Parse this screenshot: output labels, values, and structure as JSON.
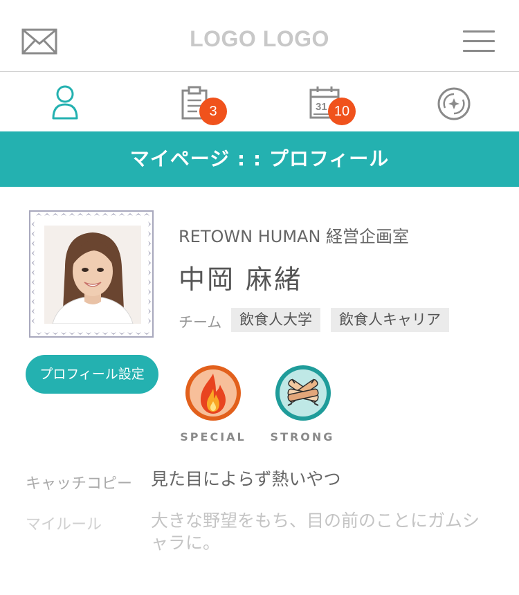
{
  "header": {
    "logo_text": "LOGO LOGO",
    "mail_icon": "envelope-icon",
    "menu_icon": "hamburger-menu-icon"
  },
  "tabs": [
    {
      "icon": "user-icon",
      "active": true,
      "badge": null
    },
    {
      "icon": "clipboard-icon",
      "active": false,
      "badge": "3"
    },
    {
      "icon": "calendar-icon",
      "active": false,
      "badge": "10",
      "calendar_day": "31"
    },
    {
      "icon": "sparkle-badge-icon",
      "active": false,
      "badge": null
    }
  ],
  "page_title": "マイページ : : プロフィール",
  "profile": {
    "company": "RETOWN HUMAN 経営企画室",
    "name": "中岡 麻緒",
    "team_label": "チーム",
    "teams": [
      "飲食人大学",
      "飲食人キャリア"
    ],
    "settings_button": "プロフィール設定",
    "badges": [
      {
        "label": "SPECIAL",
        "icon": "flame-icon"
      },
      {
        "label": "STRONG",
        "icon": "stacked-hands-icon"
      }
    ]
  },
  "details": [
    {
      "label": "キャッチコピー",
      "value": "見た目によらず熱いやつ"
    },
    {
      "label": "マイルール",
      "value": "大きな野望をもち、目の前のことにガムシャラに。"
    }
  ],
  "colors": {
    "accent": "#24b1b0",
    "badge": "#f0521c",
    "logo": "#c8c8c8",
    "special_ring": "#e2601c",
    "strong_ring": "#1f9c9a"
  }
}
